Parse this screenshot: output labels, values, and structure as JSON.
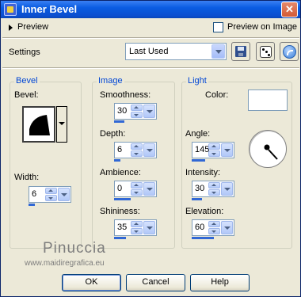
{
  "window": {
    "title": "Inner Bevel",
    "close_label": "✕"
  },
  "preview_row": {
    "preview_label": "Preview",
    "preview_on_image_label": "Preview on Image",
    "preview_on_image_checked": false
  },
  "settings": {
    "label": "Settings",
    "preset_value": "Last Used"
  },
  "toolbar": {
    "save_icon": "save-icon",
    "randomize_icon": "dice-icon",
    "reset_icon": "reset-icon"
  },
  "bevel_group": {
    "title": "Bevel",
    "bevel_label": "Bevel:",
    "width_label": "Width:",
    "width_value": "6",
    "width_fraction": 0.2
  },
  "image_group": {
    "title": "Image",
    "smoothness_label": "Smoothness:",
    "smoothness_value": "30",
    "smoothness_fraction": 0.3,
    "depth_label": "Depth:",
    "depth_value": "6",
    "depth_fraction": 0.2,
    "ambience_label": "Ambience:",
    "ambience_value": "0",
    "ambience_fraction": 0.5,
    "shininess_label": "Shininess:",
    "shininess_value": "35",
    "shininess_fraction": 0.35
  },
  "light_group": {
    "title": "Light",
    "color_label": "Color:",
    "color_value": "#ffffff",
    "angle_label": "Angle:",
    "angle_value": "145",
    "angle_fraction": 0.4,
    "intensity_label": "Intensity:",
    "intensity_value": "30",
    "intensity_fraction": 0.3,
    "elevation_label": "Elevation:",
    "elevation_value": "60",
    "elevation_fraction": 0.67
  },
  "watermark": {
    "brand": "Pinuccia",
    "url": "www.maidiregrafica.eu"
  },
  "buttons": {
    "ok_label": "OK",
    "cancel_label": "Cancel",
    "help_label": "Help"
  },
  "colors": {
    "title_bar": "#0a5ce1",
    "group_title": "#0046d5",
    "dialog_bg": "#ece9d8"
  }
}
